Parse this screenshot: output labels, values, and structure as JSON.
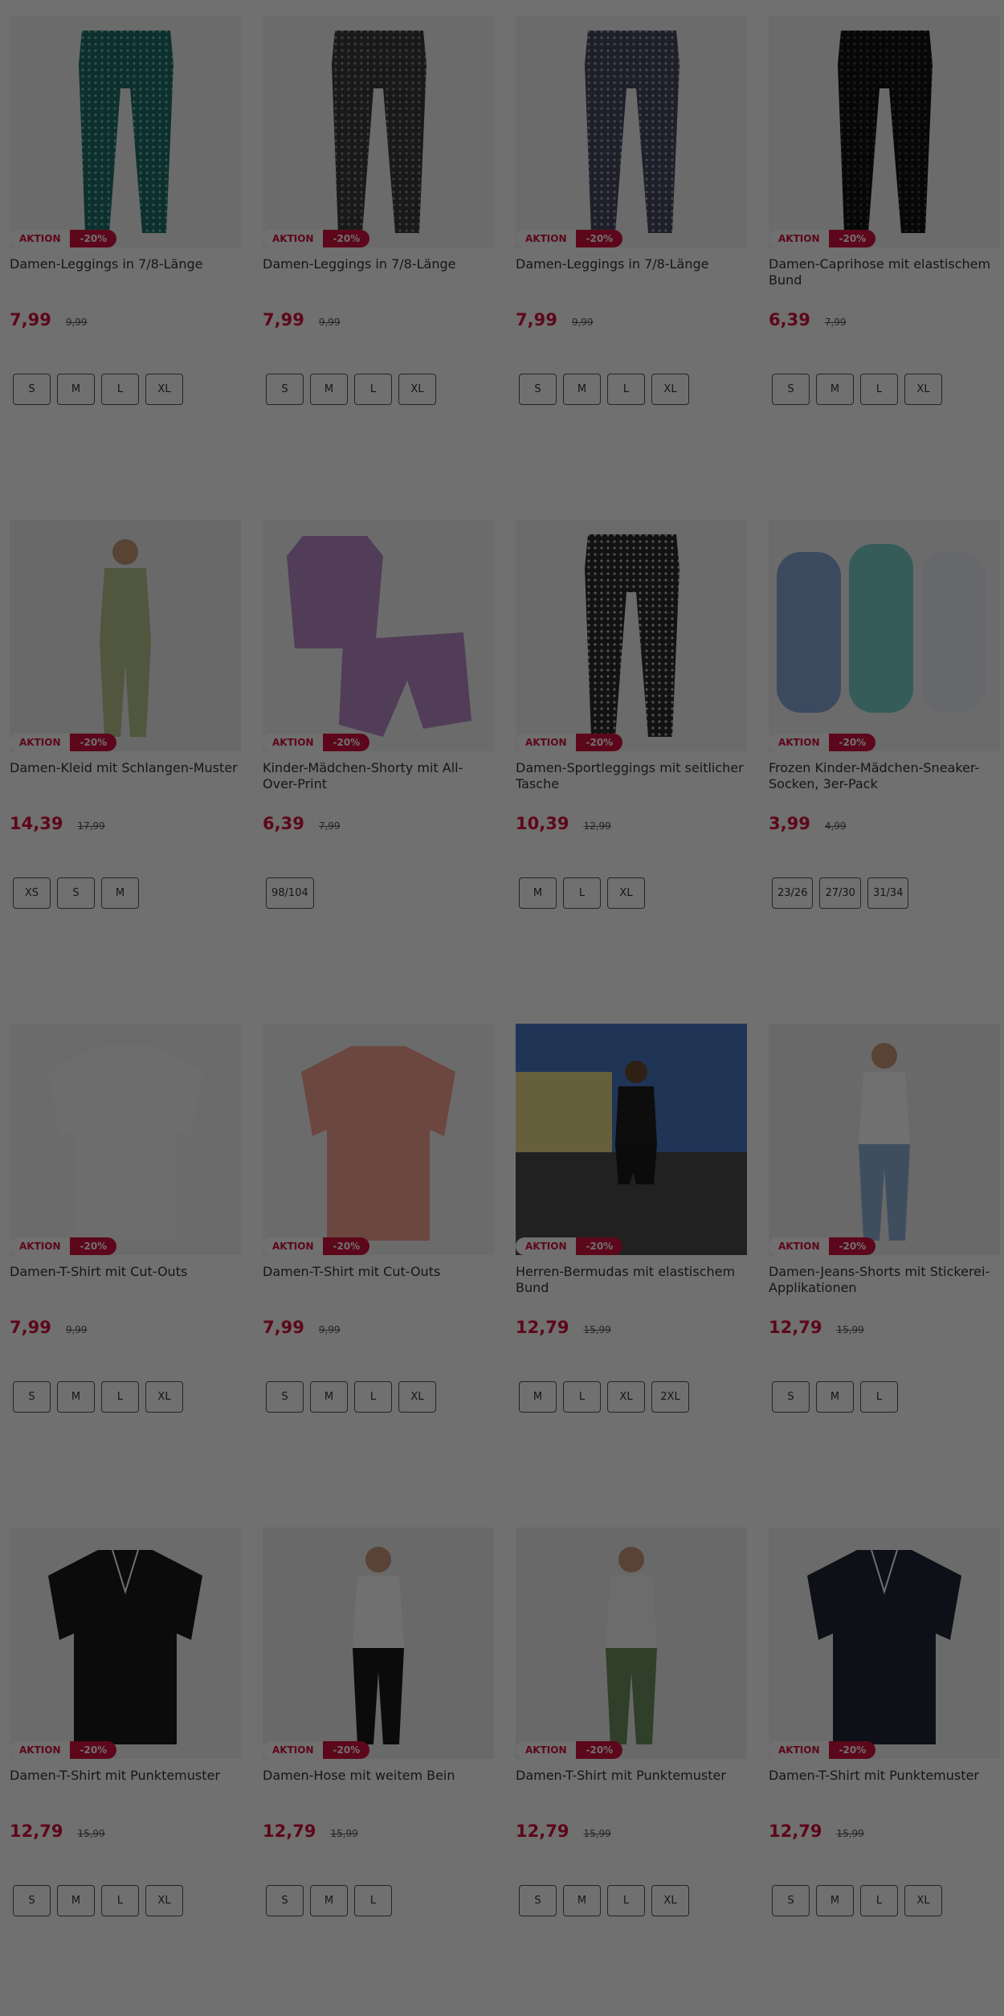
{
  "badge_label": "AKTION",
  "colors": {
    "accent": "#d4123b",
    "overlay": "rgba(0,0,0,0.56)"
  },
  "products": [
    {
      "name": "Damen-Leggings in 7/8-Länge",
      "price": "7,99",
      "old_price": "9,99",
      "discount": "-20%",
      "sizes": [
        "S",
        "M",
        "L",
        "XL"
      ],
      "image": "leggings-teal-print"
    },
    {
      "name": "Damen-Leggings in 7/8-Länge",
      "price": "7,99",
      "old_price": "9,99",
      "discount": "-20%",
      "sizes": [
        "S",
        "M",
        "L",
        "XL"
      ],
      "image": "leggings-dark-print"
    },
    {
      "name": "Damen-Leggings in 7/8-Länge",
      "price": "7,99",
      "old_price": "9,99",
      "discount": "-20%",
      "sizes": [
        "S",
        "M",
        "L",
        "XL"
      ],
      "image": "leggings-navy-print"
    },
    {
      "name": "Damen-Caprihose mit elastischem Bund",
      "price": "6,39",
      "old_price": "7,99",
      "discount": "-20%",
      "sizes": [
        "S",
        "M",
        "L",
        "XL"
      ],
      "image": "capri-black"
    },
    {
      "name": "Damen-Kleid mit Schlangen-Muster",
      "price": "14,39",
      "old_price": "17,99",
      "discount": "-20%",
      "sizes": [
        "XS",
        "S",
        "M"
      ],
      "image": "dress-snake-pattern"
    },
    {
      "name": "Kinder-Mädchen-Shorty mit All-Over-Print",
      "price": "6,39",
      "old_price": "7,99",
      "discount": "-20%",
      "sizes": [
        "98/104"
      ],
      "image": "girls-shorty-lilac"
    },
    {
      "name": "Damen-Sportleggings mit seitlicher Tasche",
      "price": "10,39",
      "old_price": "12,99",
      "discount": "-20%",
      "sizes": [
        "M",
        "L",
        "XL"
      ],
      "image": "sport-leggings-camo"
    },
    {
      "name": "Frozen Kinder-Mädchen-Sneaker-Socken, 3er-Pack",
      "price": "3,99",
      "old_price": "4,99",
      "discount": "-20%",
      "sizes": [
        "23/26",
        "27/30",
        "31/34"
      ],
      "image": "frozen-socks"
    },
    {
      "name": "Damen-T-Shirt mit Cut-Outs",
      "price": "7,99",
      "old_price": "9,99",
      "discount": "-20%",
      "sizes": [
        "S",
        "M",
        "L",
        "XL"
      ],
      "image": "tshirt-white"
    },
    {
      "name": "Damen-T-Shirt mit Cut-Outs",
      "price": "7,99",
      "old_price": "9,99",
      "discount": "-20%",
      "sizes": [
        "S",
        "M",
        "L",
        "XL"
      ],
      "image": "tshirt-coral"
    },
    {
      "name": "Herren-Bermudas mit elastischem Bund",
      "price": "12,79",
      "old_price": "15,99",
      "discount": "-20%",
      "sizes": [
        "M",
        "L",
        "XL",
        "2XL"
      ],
      "image": "men-bermudas"
    },
    {
      "name": "Damen-Jeans-Shorts mit Stickerei-Applikationen",
      "price": "12,79",
      "old_price": "15,99",
      "discount": "-20%",
      "sizes": [
        "S",
        "M",
        "L"
      ],
      "image": "jeans-shorts"
    },
    {
      "name": "Damen-T-Shirt mit Punktemuster",
      "price": "12,79",
      "old_price": "15,99",
      "discount": "-20%",
      "sizes": [
        "S",
        "M",
        "L",
        "XL"
      ],
      "image": "dotted-blouse-black"
    },
    {
      "name": "Damen-Hose mit weitem Bein",
      "price": "12,79",
      "old_price": "15,99",
      "discount": "-20%",
      "sizes": [
        "S",
        "M",
        "L"
      ],
      "image": "wide-leg-pants"
    },
    {
      "name": "Damen-T-Shirt mit Punktemuster",
      "price": "12,79",
      "old_price": "15,99",
      "discount": "-20%",
      "sizes": [
        "S",
        "M",
        "L",
        "XL"
      ],
      "image": "dotted-blouse-white"
    },
    {
      "name": "Damen-T-Shirt mit Punktemuster",
      "price": "12,79",
      "old_price": "15,99",
      "discount": "-20%",
      "sizes": [
        "S",
        "M",
        "L",
        "XL"
      ],
      "image": "dotted-blouse-navy"
    }
  ]
}
